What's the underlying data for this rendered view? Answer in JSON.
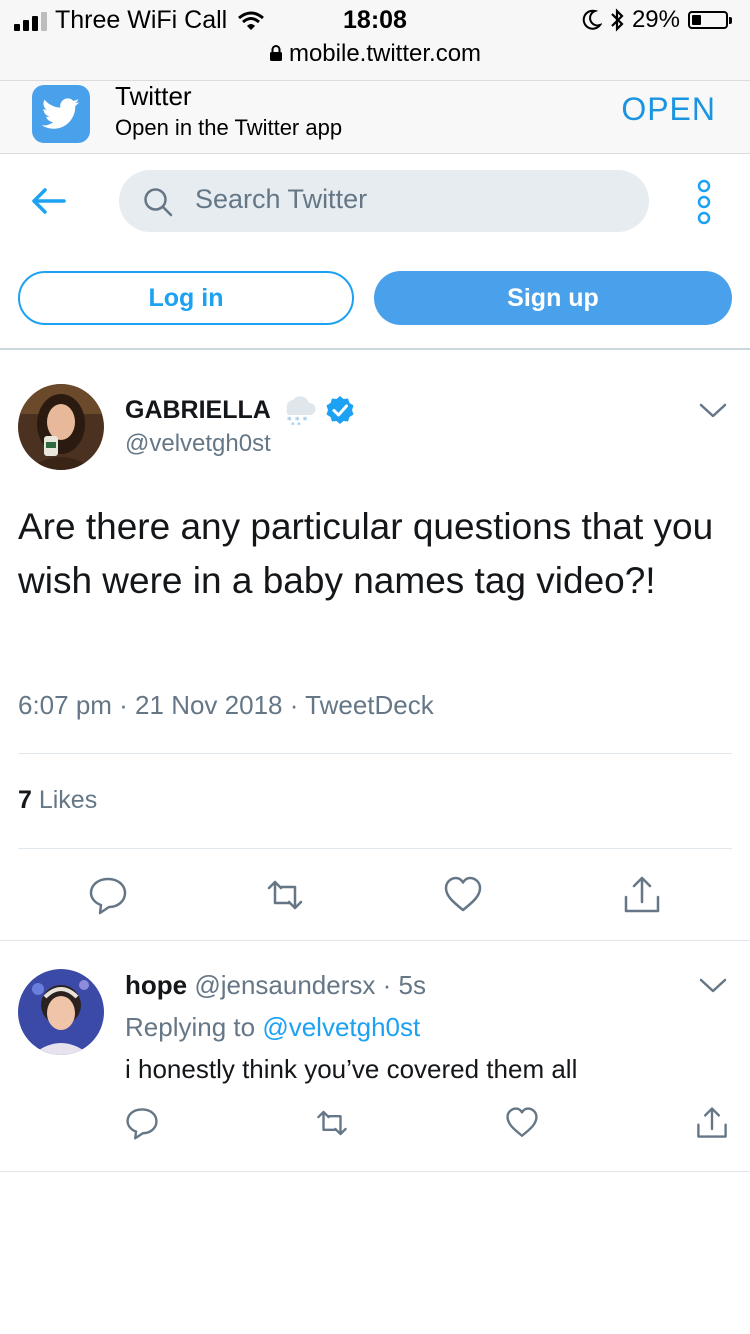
{
  "status_bar": {
    "carrier": "Three WiFi Call",
    "time": "18:08",
    "battery": "29%",
    "battery_level": 0.29,
    "url": "mobile.twitter.com"
  },
  "app_banner": {
    "title": "Twitter",
    "subtitle": "Open in the Twitter app",
    "open_label": "OPEN"
  },
  "header": {
    "search_placeholder": "Search Twitter",
    "login_label": "Log in",
    "signup_label": "Sign up"
  },
  "tweet": {
    "display_name": "GABRIELLA",
    "handle": "@velvetgh0st",
    "text": "Are there any particular questions that you wish were in a baby names tag video?!",
    "meta": "6:07 pm · 21 Nov 2018 · TweetDeck",
    "likes_count": "7",
    "likes_label": " Likes"
  },
  "reply": {
    "display_name": "hope",
    "handle_time": " @jensaundersx · 5s",
    "replying_prefix": "Replying to ",
    "replying_to": "@velvetgh0st",
    "text": "i honestly think you’ve covered them all"
  },
  "colors": {
    "accent": "#1da1f2",
    "signup_bg": "#4aa1eb",
    "muted": "#657786",
    "search_bg": "#e6ecf0"
  },
  "icons": [
    "back-arrow-icon",
    "search-icon",
    "more-vertical-icon",
    "twitter-bird-icon",
    "snow-cloud-emoji-icon",
    "verified-badge-icon",
    "chevron-down-icon",
    "reply-icon",
    "retweet-icon",
    "like-icon",
    "share-icon"
  ]
}
